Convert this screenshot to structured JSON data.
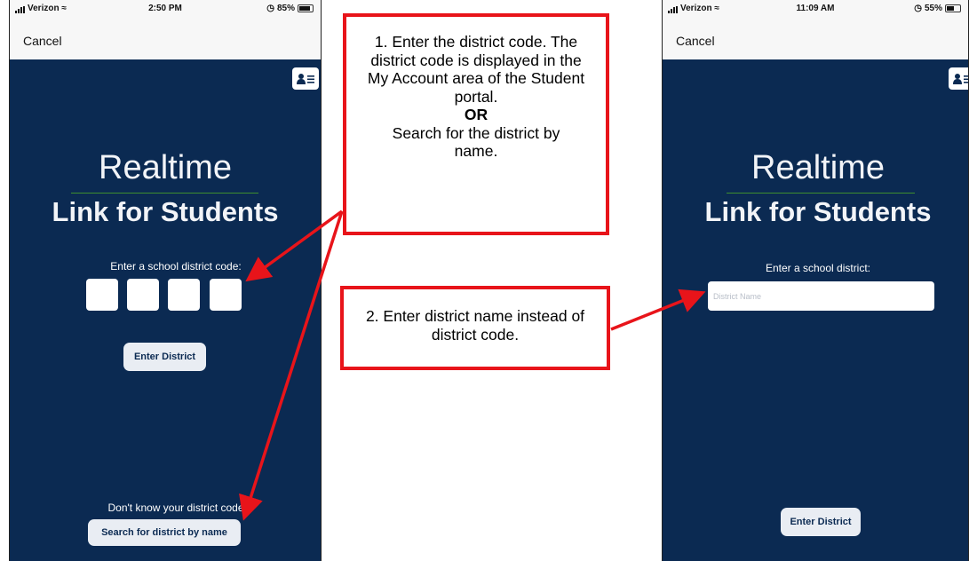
{
  "left_phone": {
    "status": {
      "carrier": "Verizon",
      "time": "2:50 PM",
      "battery": "85%",
      "battery_level": 0.85
    },
    "cancel_label": "Cancel",
    "logo_title": "Realtime",
    "logo_subtitle": "Link for Students",
    "code_prompt": "Enter a school district code:",
    "enter_button": "Enter District",
    "dont_know": "Don't know your district code",
    "search_button": "Search for district by name"
  },
  "right_phone": {
    "status": {
      "carrier": "Verizon",
      "time": "11:09 AM",
      "battery": "55%",
      "battery_level": 0.55
    },
    "cancel_label": "Cancel",
    "logo_title": "Realtime",
    "logo_subtitle": "Link for Students",
    "district_prompt": "Enter a school district:",
    "district_placeholder": "District Name",
    "enter_button": "Enter District"
  },
  "callout_1": {
    "text_a": "1. Enter the district code. The district code is displayed in the My Account area of the Student portal.",
    "or": "OR",
    "text_b": "Search for the district by name."
  },
  "callout_2": {
    "text": "2. Enter district name instead of district code."
  },
  "colors": {
    "screen_bg": "#0b2a52",
    "callout_border": "#e8141a",
    "arrow": "#e8141a",
    "logo_divider": "#3f8f2e"
  }
}
